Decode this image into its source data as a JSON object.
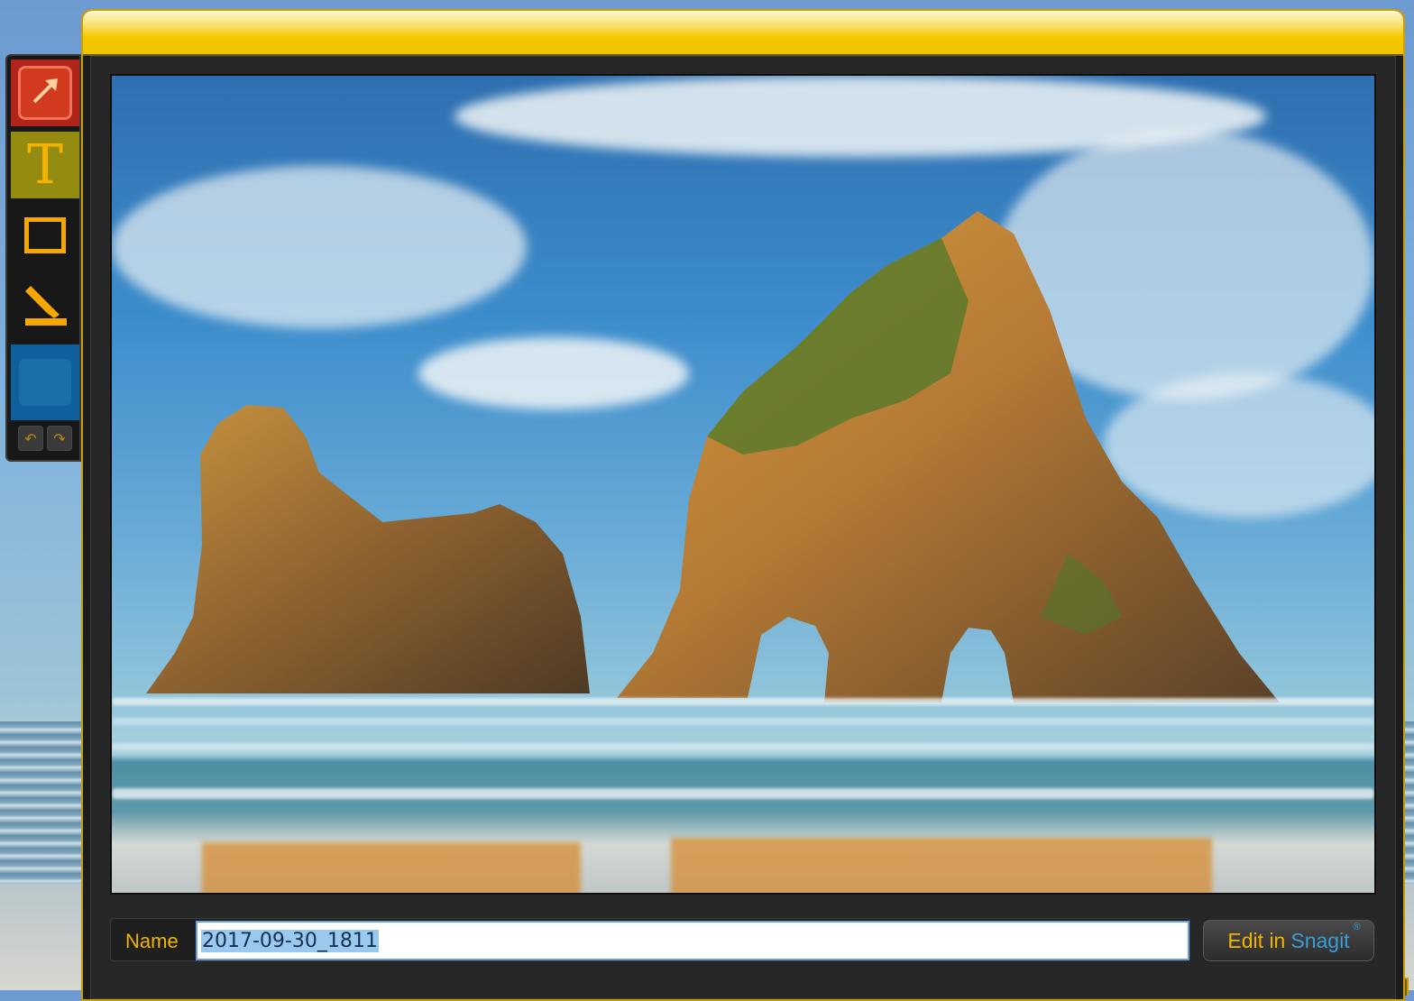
{
  "window": {
    "title": ""
  },
  "toolbar": {
    "tools": [
      {
        "name": "arrow",
        "icon": "arrow-icon",
        "selected": true
      },
      {
        "name": "text",
        "icon": "text-icon",
        "label": "T"
      },
      {
        "name": "rectangle",
        "icon": "rectangle-icon"
      },
      {
        "name": "highlighter",
        "icon": "highlighter-icon"
      },
      {
        "name": "color",
        "icon": "color-swatch-icon",
        "color": "#1b6fa8"
      }
    ],
    "undo_icon": "undo-icon",
    "redo_icon": "redo-icon"
  },
  "preview": {
    "description_icon": "captured-image"
  },
  "footer": {
    "name_label": "Name",
    "name_value": "2017-09-30_1811",
    "edit_button": {
      "prefix": "Edit in",
      "brand": "Snagit",
      "mark": "®"
    }
  },
  "colors": {
    "accent": "#f3b400",
    "titlebar": "#f4c800",
    "brand": "#3a9fd8",
    "selected_tool": "#b0241a"
  }
}
